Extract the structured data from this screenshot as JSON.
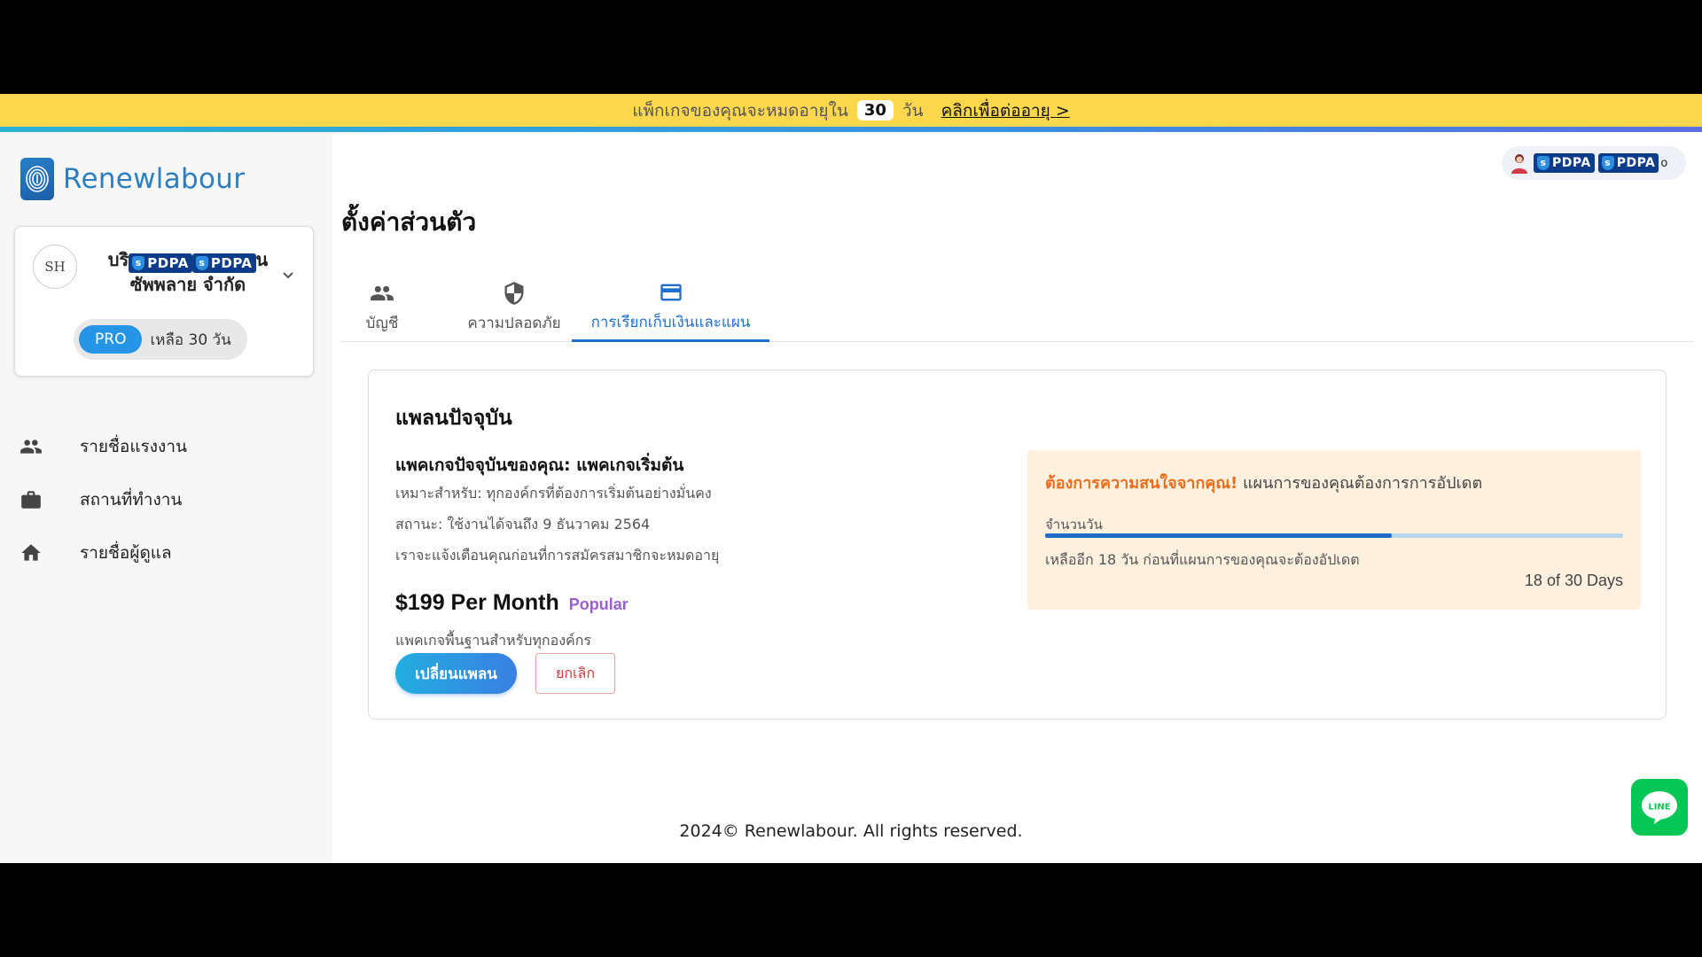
{
  "banner": {
    "prefix": "แพ็กเกจของคุณจะหมดอายุใน",
    "days": "30",
    "suffix": "วัน",
    "renew_link": "คลิกเพื่อต่ออายุ >"
  },
  "logo": {
    "text": "Renewlabour",
    "icon": "fingerprint-icon"
  },
  "company": {
    "avatar_text": "SH",
    "name_line1_start": "บริ",
    "name_line1_end": "น",
    "name_line2": "ซัพพลาย จำกัด",
    "redaction_label": "PDPA",
    "plan_badge": "PRO",
    "days_left": "เหลือ 30 วัน"
  },
  "nav": {
    "items": [
      {
        "label": "รายชื่อแรงงาน",
        "icon": "people-icon"
      },
      {
        "label": "สถานที่ทำงาน",
        "icon": "briefcase-icon"
      },
      {
        "label": "รายชื่อผู้ดูแล",
        "icon": "home-icon"
      }
    ]
  },
  "user": {
    "redaction_label": "PDPA",
    "name_tail": "o"
  },
  "page": {
    "title": "ตั้งค่าส่วนตัว"
  },
  "tabs": [
    {
      "label": "บัญชี",
      "icon": "people-icon"
    },
    {
      "label": "ความปลอดภัย",
      "icon": "shield-icon"
    },
    {
      "label": "การเรียกเก็บเงินและแผน",
      "icon": "credit-card-icon"
    }
  ],
  "active_tab": 2,
  "plan": {
    "heading": "แพลนปัจจุบัน",
    "package_line": "แพคเกจปัจจุบันของคุณ: แพคเกจเริ่มต้น",
    "suitable": "เหมาะสำหรับ: ทุกองค์กรที่ต้องการเริ่มต้นอย่างมั่นคง",
    "status": "สถานะ: ใช้งานได้จนถึง 9 ธันวาคม 2564",
    "notice": "เราจะแจ้งเตือนคุณก่อนที่การสมัครสมาชิกจะหมดอายุ",
    "price": "$199 Per Month",
    "popular": "Popular",
    "price_sub": "แพคเกจพื้นฐานสำหรับทุกองค์กร",
    "change_button": "เปลี่ยนแพลน",
    "cancel_button": "ยกเลิก"
  },
  "attention": {
    "strong": "ต้องการความสนใจจากคุณ!",
    "text": "แผนการของคุณต้องการการอัปเดต",
    "days_label": "จำนวนวัน",
    "progress": 0.6,
    "remain": "เหลืออีก 18 วัน ก่อนที่แผนการของคุณจะต้องอัปเดต",
    "count": "18 of 30 Days"
  },
  "footer": {
    "text": "2024© Renewlabour. All rights reserved."
  },
  "line_button": {
    "label": "LINE"
  },
  "colors": {
    "banner": "#fed84c",
    "accent": "#1e6fd0",
    "pro_badge": "#2795e6",
    "attention_bg": "#fff0df",
    "attention_strong": "#ef6c1a",
    "line_green": "#06c755",
    "cancel_red": "#d23a3a",
    "popular_purple": "#9a5fd0"
  }
}
